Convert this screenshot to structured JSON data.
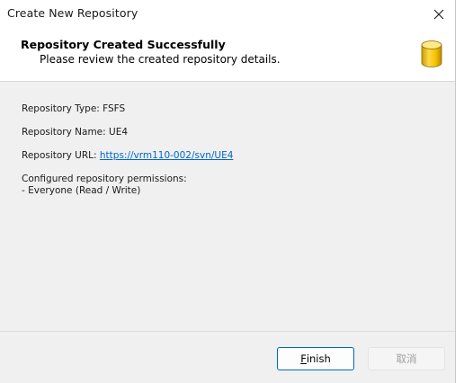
{
  "window": {
    "title": "Create New Repository"
  },
  "header": {
    "title": "Repository Created Successfully",
    "subtitle": "Please review the created repository details.",
    "icon": "database-icon"
  },
  "details": {
    "type_label": "Repository Type: FSFS",
    "name_label": "Repository Name: UE4",
    "url_prefix": "Repository URL: ",
    "url": "https://vrm110-002/svn/UE4",
    "permissions_heading": "Configured repository permissions:",
    "permissions": [
      "- Everyone (Read / Write)"
    ]
  },
  "buttons": {
    "finish_mnemonic": "F",
    "finish_rest": "inish",
    "cancel": "取消"
  },
  "colors": {
    "link": "#0066cc",
    "accent_border": "#0067c0",
    "icon_gold": "#f5c400"
  }
}
